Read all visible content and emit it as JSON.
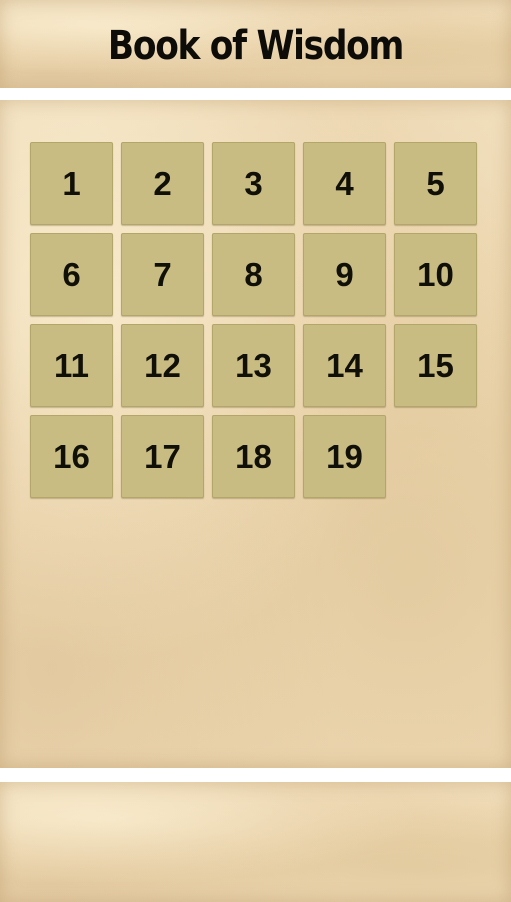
{
  "header": {
    "title": "Book of Wisdom"
  },
  "chapters": [
    {
      "label": "1"
    },
    {
      "label": "2"
    },
    {
      "label": "3"
    },
    {
      "label": "4"
    },
    {
      "label": "5"
    },
    {
      "label": "6"
    },
    {
      "label": "7"
    },
    {
      "label": "8"
    },
    {
      "label": "9"
    },
    {
      "label": "10"
    },
    {
      "label": "11"
    },
    {
      "label": "12"
    },
    {
      "label": "13"
    },
    {
      "label": "14"
    },
    {
      "label": "15"
    },
    {
      "label": "16"
    },
    {
      "label": "17"
    },
    {
      "label": "18"
    },
    {
      "label": "19"
    }
  ],
  "colors": {
    "parchment": "#efdcb8",
    "tile": "#c8bc82",
    "tile_border": "#b3a66b",
    "text": "#111008"
  }
}
